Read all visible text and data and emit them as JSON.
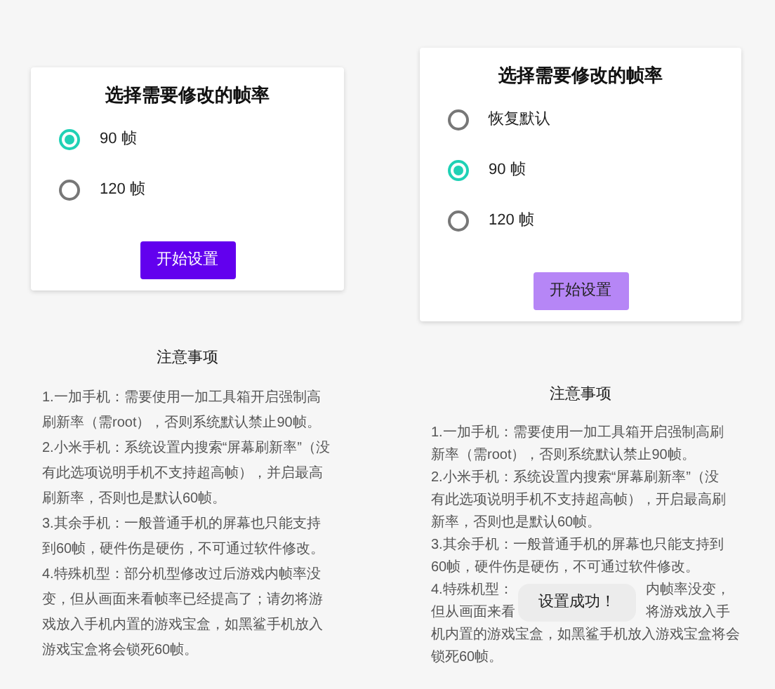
{
  "screens": [
    {
      "card": {
        "title": "选择需要修改的帧率",
        "options": [
          {
            "label": "90 帧",
            "selected": true
          },
          {
            "label": "120 帧",
            "selected": false
          }
        ],
        "button": {
          "label": "开始设置",
          "disabled": false
        }
      },
      "notes": {
        "title": "注意事项",
        "paragraphs": [
          {
            "kind": "text",
            "text": "1.一加手机：需要使用一加工具箱开启强制高刷新率（需root），否则系统默认禁止90帧。"
          },
          {
            "kind": "text",
            "text": "2.小米手机：系统设置内搜索“屏幕刷新率”（没有此选项说明手机不支持超高帧），并启最高刷新率，否则也是默认60帧。"
          },
          {
            "kind": "text",
            "text": "3.其余手机：一般普通手机的屏幕也只能支持到60帧，硬件伤是硬伤，不可通过软件修改。"
          },
          {
            "kind": "text",
            "text": "4.特殊机型：部分机型修改过后游戏内帧率没变，但从画面来看帧率已经提高了；请勿将游戏放入手机内置的游戏宝盒，如黑鲨手机放入游戏宝盒将会锁死60帧。"
          }
        ]
      }
    },
    {
      "card": {
        "title": "选择需要修改的帧率",
        "options": [
          {
            "label": "恢复默认",
            "selected": false
          },
          {
            "label": "90 帧",
            "selected": true
          },
          {
            "label": "120 帧",
            "selected": false
          }
        ],
        "button": {
          "label": "开始设置",
          "disabled": true
        }
      },
      "notes": {
        "title": "注意事项",
        "paragraphs": [
          {
            "kind": "text",
            "text": "1.一加手机：需要使用一加工具箱开启强制高刷新率（需root），否则系统默认禁止90帧。"
          },
          {
            "kind": "text",
            "text": "2.小米手机：系统设置内搜索“屏幕刷新率”（没有此选项说明手机不支持超高帧），开启最高刷新率，否则也是默认60帧。"
          },
          {
            "kind": "text",
            "text": "3.其余手机：一般普通手机的屏幕也只能支持到60帧，硬件伤是硬伤，不可通过软件修改。"
          },
          {
            "kind": "lines",
            "lines": [
              [
                "4.特殊机型：",
                "内帧率没变，"
              ],
              [
                "但从画面来看",
                "将游戏放入手"
              ],
              [
                "机内置的游戏宝盒，如黑鲨手机放入游戏宝盒将会"
              ],
              [
                "锁死60帧。"
              ]
            ],
            "toast": "设置成功！"
          }
        ]
      }
    }
  ]
}
